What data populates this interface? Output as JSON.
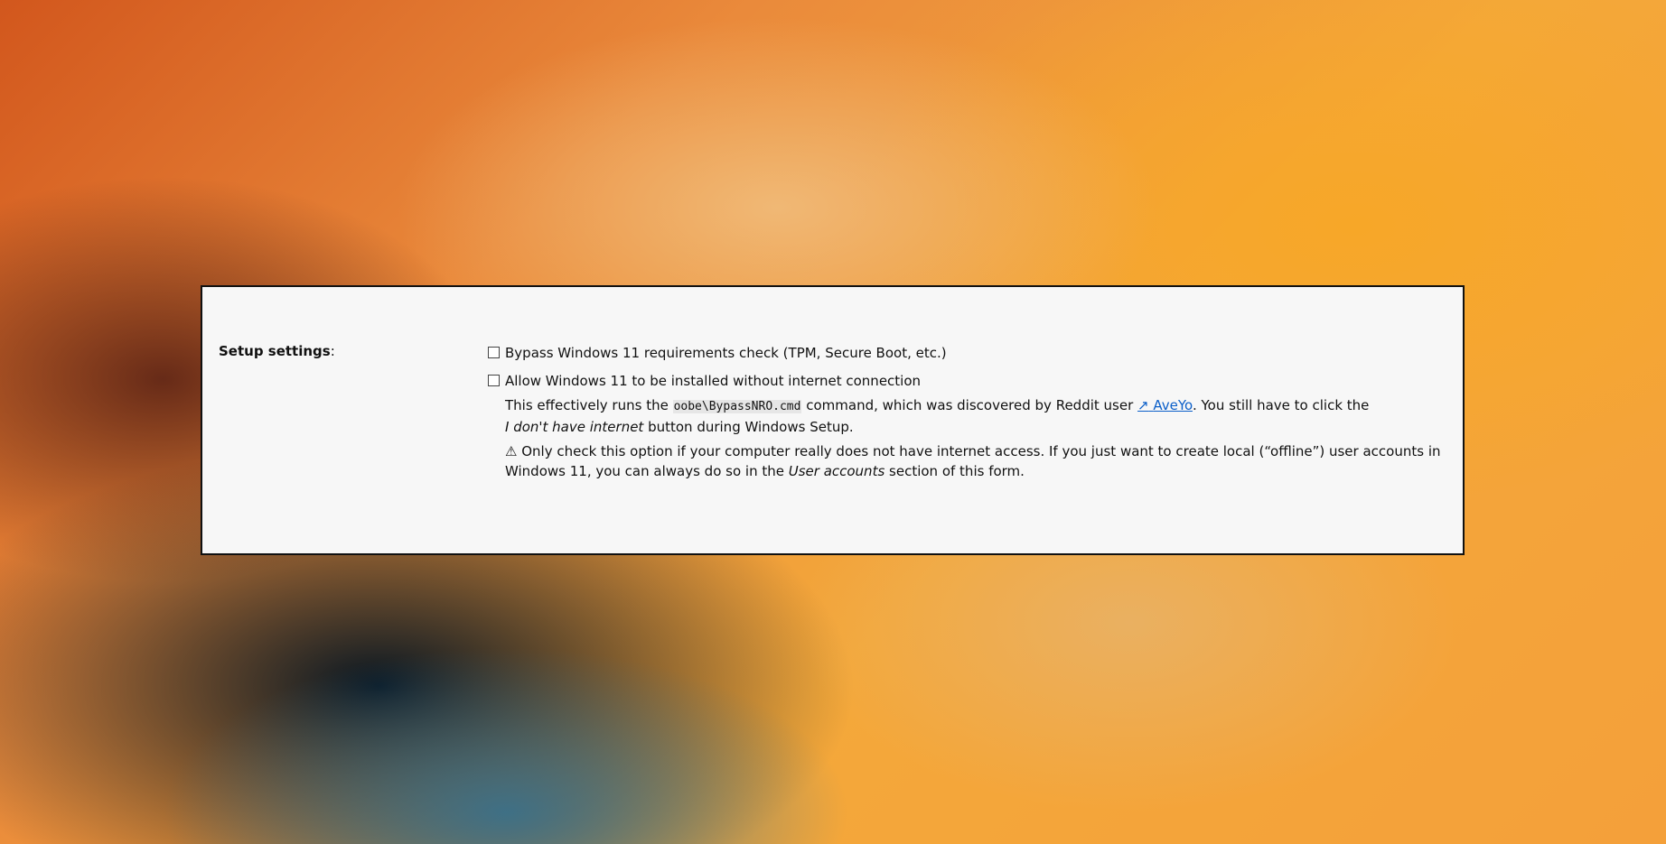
{
  "form": {
    "section_label": "Setup settings",
    "section_label_suffix": ":",
    "options": [
      {
        "label": "Bypass Windows 11 requirements check (TPM, Secure Boot, etc.)",
        "checked": false
      },
      {
        "label": "Allow Windows 11 to be installed without internet connection",
        "checked": false
      }
    ],
    "nro_description": {
      "part1": "This effectively runs the ",
      "command": "oobe\\BypassNRO.cmd",
      "part2": " command, which was discovered by Reddit user ",
      "link_icon": "↗",
      "link_text": "AveYo",
      "part3": ". You still have to click the",
      "button_name": "I don't have internet",
      "part4": " button during Windows Setup."
    },
    "warning": {
      "icon": "⚠",
      "part1": " Only check this option if your computer really does not have internet access. If you just want to create local (“offline”) user accounts in Windows 11, you can always do so in the ",
      "section_name": "User accounts",
      "part2": " section of this form."
    }
  }
}
